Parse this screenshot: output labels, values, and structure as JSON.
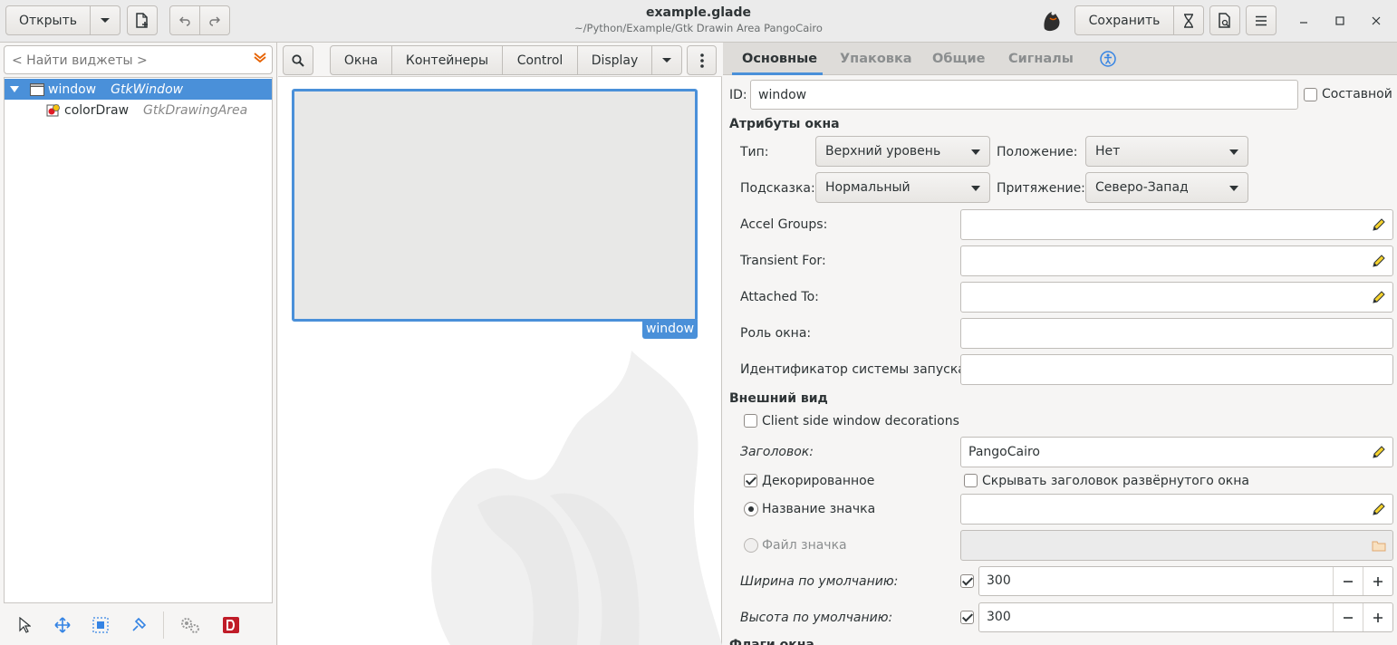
{
  "header": {
    "title": "example.glade",
    "subtitle": "~/Python/Example/Gtk Drawin Area PangoCairo",
    "open_label": "Открыть",
    "save_label": "Сохранить"
  },
  "left": {
    "search_placeholder": "< Найти виджеты >",
    "tree": [
      {
        "name": "window",
        "type": "GtkWindow",
        "selected": true
      },
      {
        "name": "colorDraw",
        "type": "GtkDrawingArea",
        "selected": false
      }
    ]
  },
  "palette": {
    "groups": [
      "Окна",
      "Контейнеры",
      "Control",
      "Display"
    ]
  },
  "canvas": {
    "selected_label": "window"
  },
  "inspector": {
    "tabs": [
      "Основные",
      "Упаковка",
      "Общие",
      "Сигналы"
    ],
    "id_label": "ID:",
    "id_value": "window",
    "composite_label": "Составной",
    "section_window": "Атрибуты окна",
    "type_label": "Тип:",
    "type_value": "Верхний уровень",
    "position_label": "Положение:",
    "position_value": "Нет",
    "hint_label": "Подсказка:",
    "hint_value": "Нормальный",
    "gravity_label": "Притяжение:",
    "gravity_value": "Северо-Запад",
    "accel_label": "Accel Groups:",
    "transient_label": "Transient For:",
    "attached_label": "Attached To:",
    "role_label": "Роль окна:",
    "startup_label": "Идентификатор системы запуска:",
    "section_appearance": "Внешний вид",
    "csd_label": "Client side window decorations",
    "title_label": "Заголовок:",
    "title_value": "PangoCairo",
    "decorated_label": "Декорированное",
    "hide_title_label": "Скрывать заголовок развёрнутого окна",
    "icon_name_label": "Название значка",
    "icon_file_label": "Файл значка",
    "width_label": "Ширина по умолчанию:",
    "width_value": "300",
    "height_label": "Высота по умолчанию:",
    "height_value": "300",
    "section_flags_partial": "Флаги окна"
  }
}
